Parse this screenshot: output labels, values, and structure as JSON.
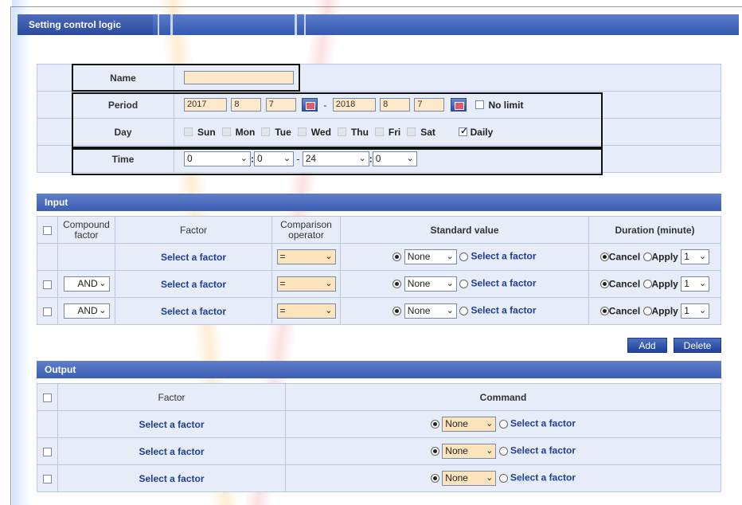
{
  "title": "Setting control logic",
  "basic": {
    "name_label": "Name",
    "name_value": "",
    "period_label": "Period",
    "period_start": {
      "year": "2017",
      "month": "8",
      "day": "7"
    },
    "period_sep": "-",
    "period_end": {
      "year": "2018",
      "month": "8",
      "day": "7"
    },
    "no_limit_label": "No limit",
    "day_label": "Day",
    "days": [
      "Sun",
      "Mon",
      "Tue",
      "Wed",
      "Thu",
      "Fri",
      "Sat"
    ],
    "daily_label": "Daily",
    "daily_checked": true,
    "time_label": "Time",
    "time": {
      "start_hour": "0",
      "start_min": "0",
      "dash": "-",
      "end_hour": "24",
      "end_min": "0",
      "colon": ":"
    }
  },
  "input": {
    "heading": "Input",
    "headers": {
      "compound": "Compound factor",
      "factor": "Factor",
      "comparison": "Comparison operator",
      "standard": "Standard value",
      "duration": "Duration (minute)"
    },
    "rows": [
      {
        "compound": "",
        "factor": "Select a factor",
        "operator": "=",
        "std_select": "None",
        "std_factor": "Select a factor",
        "cancel": "Cancel",
        "apply": "Apply",
        "duration": "1"
      },
      {
        "compound": "AND",
        "factor": "Select a factor",
        "operator": "=",
        "std_select": "None",
        "std_factor": "Select a factor",
        "cancel": "Cancel",
        "apply": "Apply",
        "duration": "1"
      },
      {
        "compound": "AND",
        "factor": "Select a factor",
        "operator": "=",
        "std_select": "None",
        "std_factor": "Select a factor",
        "cancel": "Cancel",
        "apply": "Apply",
        "duration": "1"
      }
    ],
    "add_label": "Add",
    "delete_label": "Delete"
  },
  "output": {
    "heading": "Output",
    "headers": {
      "factor": "Factor",
      "command": "Command"
    },
    "rows": [
      {
        "factor": "Select a factor",
        "cmd_select": "None",
        "cmd_factor": "Select a factor"
      },
      {
        "factor": "Select a factor",
        "cmd_select": "None",
        "cmd_factor": "Select a factor"
      },
      {
        "factor": "Select a factor",
        "cmd_select": "None",
        "cmd_factor": "Select a factor"
      }
    ]
  },
  "colors": {
    "header_blue": "#3c5eb4",
    "cell_bg": "#e6ecf8",
    "input_tint": "#fde9c9",
    "link": "#1f3d9a"
  },
  "icons": {
    "calendar": "calendar-icon",
    "chevron": "chevron-down-icon"
  }
}
